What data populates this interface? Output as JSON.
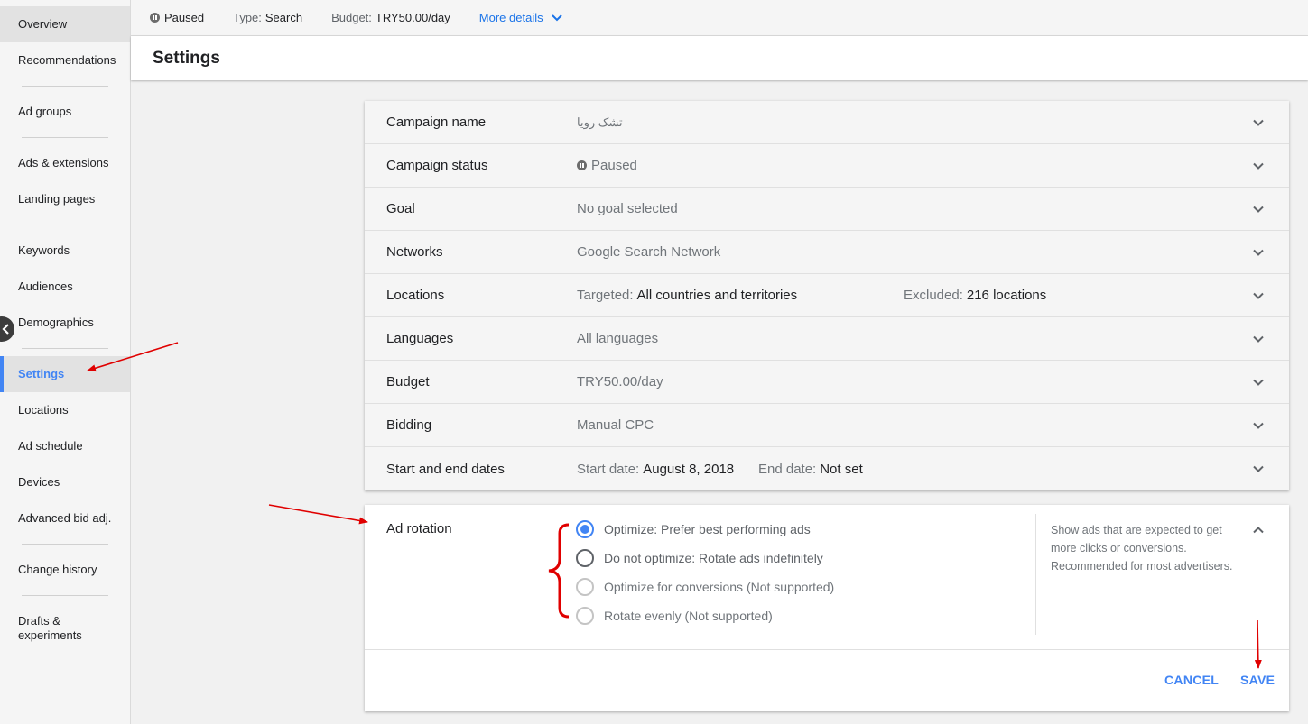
{
  "sidebar": {
    "items": [
      {
        "label": "Overview",
        "name": "sidebar-item-overview"
      },
      {
        "label": "Recommendations",
        "name": "sidebar-item-recommendations"
      },
      {
        "label": "Ad groups",
        "name": "sidebar-item-ad-groups"
      },
      {
        "label": "Ads & extensions",
        "name": "sidebar-item-ads-extensions"
      },
      {
        "label": "Landing pages",
        "name": "sidebar-item-landing-pages"
      },
      {
        "label": "Keywords",
        "name": "sidebar-item-keywords"
      },
      {
        "label": "Audiences",
        "name": "sidebar-item-audiences"
      },
      {
        "label": "Demographics",
        "name": "sidebar-item-demographics"
      },
      {
        "label": "Settings",
        "name": "sidebar-item-settings"
      },
      {
        "label": "Locations",
        "name": "sidebar-item-locations"
      },
      {
        "label": "Ad schedule",
        "name": "sidebar-item-ad-schedule"
      },
      {
        "label": "Devices",
        "name": "sidebar-item-devices"
      },
      {
        "label": "Advanced bid adj.",
        "name": "sidebar-item-advanced-bid-adj"
      },
      {
        "label": "Change history",
        "name": "sidebar-item-change-history"
      },
      {
        "label": "Drafts &",
        "label2": "experiments",
        "name": "sidebar-item-drafts-experiments"
      }
    ]
  },
  "topbar": {
    "status": "Paused",
    "type_label": "Type:",
    "type_value": "Search",
    "budget_label": "Budget:",
    "budget_value": "TRY50.00/day",
    "more_details": "More details"
  },
  "page_title": "Settings",
  "settings_rows": {
    "campaign_name": {
      "label": "Campaign name",
      "value": "تشک رویا"
    },
    "campaign_status": {
      "label": "Campaign status",
      "value": "Paused"
    },
    "goal": {
      "label": "Goal",
      "value": "No goal selected"
    },
    "networks": {
      "label": "Networks",
      "value": "Google Search Network"
    },
    "locations": {
      "label": "Locations",
      "targeted_label": "Targeted:",
      "targeted_value": "All countries and territories",
      "excluded_label": "Excluded:",
      "excluded_value": "216 locations"
    },
    "languages": {
      "label": "Languages",
      "value": "All languages"
    },
    "budget": {
      "label": "Budget",
      "value": "TRY50.00/day"
    },
    "bidding": {
      "label": "Bidding",
      "value": "Manual CPC"
    },
    "dates": {
      "label": "Start and end dates",
      "start_label": "Start date:",
      "start_value": "August 8, 2018",
      "end_label": "End date:",
      "end_value": "Not set"
    }
  },
  "ad_rotation": {
    "label": "Ad rotation",
    "options": [
      {
        "label": "Optimize: Prefer best performing ads",
        "selected": true,
        "disabled": false
      },
      {
        "label": "Do not optimize: Rotate ads indefinitely",
        "selected": false,
        "disabled": false
      },
      {
        "label": "Optimize for conversions (Not supported)",
        "selected": false,
        "disabled": true
      },
      {
        "label": "Rotate evenly (Not supported)",
        "selected": false,
        "disabled": true
      }
    ],
    "help_text": "Show ads that are expected to get more clicks or conversions. Recommended for most advertisers.",
    "cancel_label": "CANCEL",
    "save_label": "SAVE"
  },
  "colors": {
    "accent": "#4285f4",
    "annotation_red": "#e00000"
  }
}
